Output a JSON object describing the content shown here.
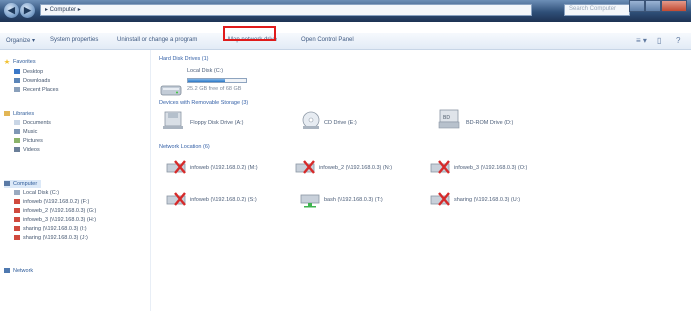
{
  "titlebar": {
    "address": "▸ Computer ▸",
    "search_placeholder": "Search Computer"
  },
  "toolbar": {
    "items": [
      "Organize ▾",
      "System properties",
      "Uninstall or change a program",
      "Map network drive",
      "Open Control Panel"
    ],
    "right_icons": [
      "≡ ▾",
      "▯",
      "?"
    ]
  },
  "sidebar": {
    "favorites": {
      "label": "Favorites",
      "items": [
        "Desktop",
        "Downloads",
        "Recent Places"
      ]
    },
    "libraries": {
      "label": "Libraries",
      "items": [
        "Documents",
        "Music",
        "Pictures",
        "Videos"
      ]
    },
    "computer": {
      "label": "Computer",
      "items": [
        "Local Disk (C:)",
        "infoweb (\\\\192.168.0.2) (F:)",
        "infoweb_2 (\\\\192.168.0.3) (G:)",
        "infoweb_3 (\\\\192.168.0.3) (H:)",
        "sharing (\\\\192.168.0.3) (I:)",
        "sharing (\\\\192.168.0.3) (J:)"
      ]
    },
    "network": {
      "label": "Network"
    }
  },
  "main": {
    "hdd": {
      "header": "Hard Disk Drives (1)",
      "drive": {
        "name": "Local Disk (C:)",
        "free": "25.2 GB free of 68 GB",
        "used_fraction": 0.63
      }
    },
    "removable": {
      "header": "Devices with Removable Storage (3)",
      "items": [
        "Floppy Disk Drive (A:)",
        "CD Drive (E:)",
        "BD-ROM Drive (D:)"
      ]
    },
    "network": {
      "header": "Network Location (6)",
      "items": [
        "infoweb (\\\\192.168.0.2) (M:)",
        "infoweb_2 (\\\\192.168.0.3) (N:)",
        "infoweb_3 (\\\\192.168.0.3) (O:)",
        "infoweb (\\\\192.168.0.2) (S:)",
        "bash (\\\\192.168.0.3) (T:)",
        "sharing (\\\\192.168.0.3) (U:)"
      ]
    }
  },
  "colors": {
    "highlight": "#e01b1b",
    "titlebar": "#2f4f78",
    "link": "#3662a8"
  }
}
